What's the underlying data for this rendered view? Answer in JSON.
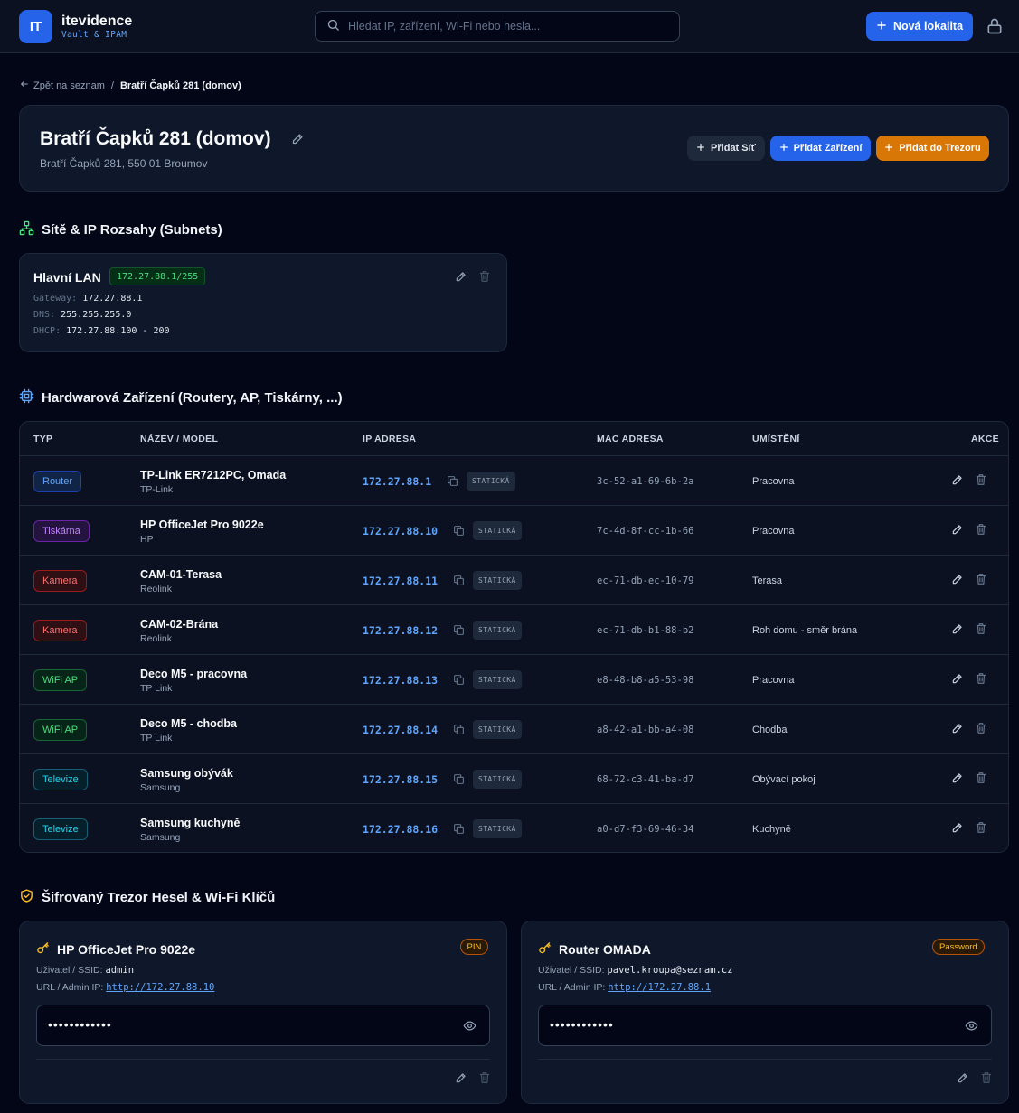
{
  "header": {
    "logo": "IT",
    "brand": "itevidence",
    "brand_sub": "Vault & IPAM",
    "search_placeholder": "Hledat IP, zařízení, Wi-Fi nebo hesla...",
    "new_location": "Nová lokalita"
  },
  "breadcrumb": {
    "back": "Zpět na seznam",
    "sep": "/",
    "current": "Bratří Čapků 281 (domov)"
  },
  "location": {
    "title": "Bratří Čapků 281 (domov)",
    "address": "Bratří Čapků 281, 550 01 Broumov",
    "add_network": "Přidat Síť",
    "add_device": "Přidat Zařízení",
    "add_vault": "Přidat do Trezoru"
  },
  "networks": {
    "title": "Sítě & IP Rozsahy (Subnets)",
    "items": [
      {
        "name": "Hlavní LAN",
        "cidr": "172.27.88.1/255",
        "gateway_label": "Gateway:",
        "gateway": "172.27.88.1",
        "dns_label": "DNS:",
        "dns": "255.255.255.0",
        "dhcp_label": "DHCP:",
        "dhcp": "172.27.88.100 - 200"
      }
    ]
  },
  "devices": {
    "title": "Hardwarová Zařízení (Routery, AP, Tiskárny, ...)",
    "columns": {
      "type": "TYP",
      "name": "NÁZEV / MODEL",
      "ip": "IP ADRESA",
      "mac": "MAC ADRESA",
      "location": "UMÍSTĚNÍ",
      "actions": "AKCE"
    },
    "static_label": "STATICKÁ",
    "rows": [
      {
        "type": "Router",
        "name": "TP-Link ER7212PC, Omada",
        "model": "TP-Link",
        "ip": "172.27.88.1",
        "mac": "3c-52-a1-69-6b-2a",
        "location": "Pracovna"
      },
      {
        "type": "Tiskárna",
        "name": "HP OfficeJet Pro 9022e",
        "model": "HP",
        "ip": "172.27.88.10",
        "mac": "7c-4d-8f-cc-1b-66",
        "location": "Pracovna"
      },
      {
        "type": "Kamera",
        "name": "CAM-01-Terasa",
        "model": "Reolink",
        "ip": "172.27.88.11",
        "mac": "ec-71-db-ec-10-79",
        "location": "Terasa"
      },
      {
        "type": "Kamera",
        "name": "CAM-02-Brána",
        "model": "Reolink",
        "ip": "172.27.88.12",
        "mac": "ec-71-db-b1-88-b2",
        "location": "Roh domu - směr brána"
      },
      {
        "type": "WiFi AP",
        "name": "Deco M5 - pracovna",
        "model": "TP Link",
        "ip": "172.27.88.13",
        "mac": "e8-48-b8-a5-53-98",
        "location": "Pracovna"
      },
      {
        "type": "WiFi AP",
        "name": "Deco M5 - chodba",
        "model": "TP Link",
        "ip": "172.27.88.14",
        "mac": "a8-42-a1-bb-a4-08",
        "location": "Chodba"
      },
      {
        "type": "Televize",
        "name": "Samsung obývák",
        "model": "Samsung",
        "ip": "172.27.88.15",
        "mac": "68-72-c3-41-ba-d7",
        "location": "Obývací pokoj"
      },
      {
        "type": "Televize",
        "name": "Samsung kuchyně",
        "model": "Samsung",
        "ip": "172.27.88.16",
        "mac": "a0-d7-f3-69-46-34",
        "location": "Kuchyně"
      }
    ]
  },
  "vault": {
    "title": "Šifrovaný Trezor Hesel & Wi-Fi Klíčů",
    "user_label": "Uživatel / SSID:",
    "url_label": "URL / Admin IP:",
    "items": [
      {
        "title": "HP OfficeJet Pro 9022e",
        "badge": "PIN",
        "user": "admin",
        "url": "http://172.27.88.10",
        "secret": "••••••••••••"
      },
      {
        "title": "Router OMADA",
        "badge": "Password",
        "user": "pavel.kroupa@seznam.cz",
        "url": "http://172.27.88.1",
        "secret": "••••••••••••"
      }
    ]
  },
  "colors": {
    "accent": "#2563eb",
    "vault": "#d97706",
    "badge_router": "#60a5fa",
    "badge_printer": "#c084fc",
    "badge_camera": "#f87171",
    "badge_wifi": "#4ade80",
    "badge_tv": "#22d3ee"
  }
}
